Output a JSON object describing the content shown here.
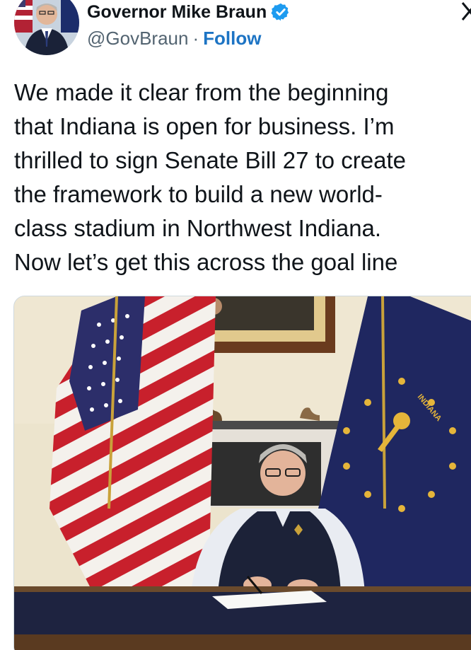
{
  "author": {
    "display_name": "Governor Mike Braun",
    "handle": "@GovBraun",
    "separator": "·",
    "follow_label": "Follow",
    "verified": true,
    "verified_color": "#1d9bf0"
  },
  "tweet": {
    "lines": [
      "We made it clear from the beginning",
      "that Indiana is open for business. I’m",
      "thrilled to sign Senate Bill 27 to create",
      "the framework to build a new world-",
      "class stadium in Northwest Indiana.",
      "Now let’s get this across the goal line"
    ]
  },
  "media": {
    "flag_text": "INDIANA",
    "icon": "photo"
  },
  "colors": {
    "follow": "#1d74c4",
    "handle": "#536471",
    "text": "#0f1419"
  }
}
